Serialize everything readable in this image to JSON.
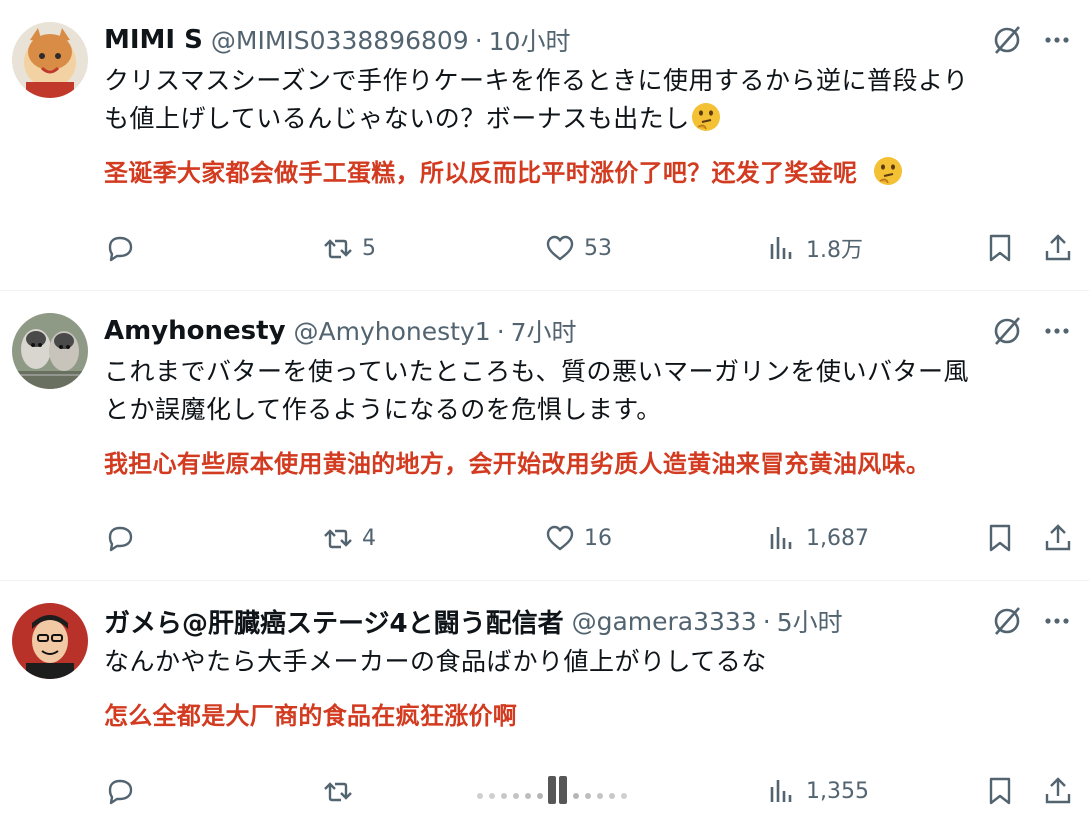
{
  "tweets": [
    {
      "name": "MIMI S",
      "handle": "@MIMIS0338896809",
      "sep": "·",
      "time": "10小时",
      "text_line1": "クリスマスシーズンで手作りケーキを作るときに使用するから逆に普段より",
      "text_line2": "も値上げしているんじゃないの？ボーナスも出たし",
      "translation": "圣诞季大家都会做手工蛋糕，所以反而比平时涨价了吧？还发了奖金呢",
      "emoji": "thinking-face",
      "retweets": "5",
      "likes": "53",
      "views": "1.8万"
    },
    {
      "name": "Amyhonesty",
      "handle": "@Amyhonesty1",
      "sep": "·",
      "time": "7小时",
      "text_line1": "これまでバターを使っていたところも、質の悪いマーガリンを使いバター風",
      "text_line2": "とか誤魔化して作るようになるのを危惧します。",
      "translation": "我担心有些原本使用黄油的地方，会开始改用劣质人造黄油来冒充黄油风味。",
      "retweets": "4",
      "likes": "16",
      "views": "1,687"
    },
    {
      "name": "ガメら@肝臓癌ステージ4と闘う配信者",
      "handle": "@gamera3333",
      "sep": "·",
      "time": "5小时",
      "text_line1": "なんかやたら大手メーカーの食品ばかり値上がりしてるな",
      "translation": "怎么全都是大厂商的食品在疯狂涨价啊",
      "retweets": "",
      "likes": "",
      "views": "1,355"
    }
  ],
  "colors": {
    "translation": "#d23b20",
    "secondary": "#536471",
    "divider": "#eff3f4"
  },
  "icons": [
    "reply-icon",
    "retweet-icon",
    "like-icon",
    "views-icon",
    "bookmark-icon",
    "share-icon",
    "grok-icon",
    "more-icon"
  ]
}
